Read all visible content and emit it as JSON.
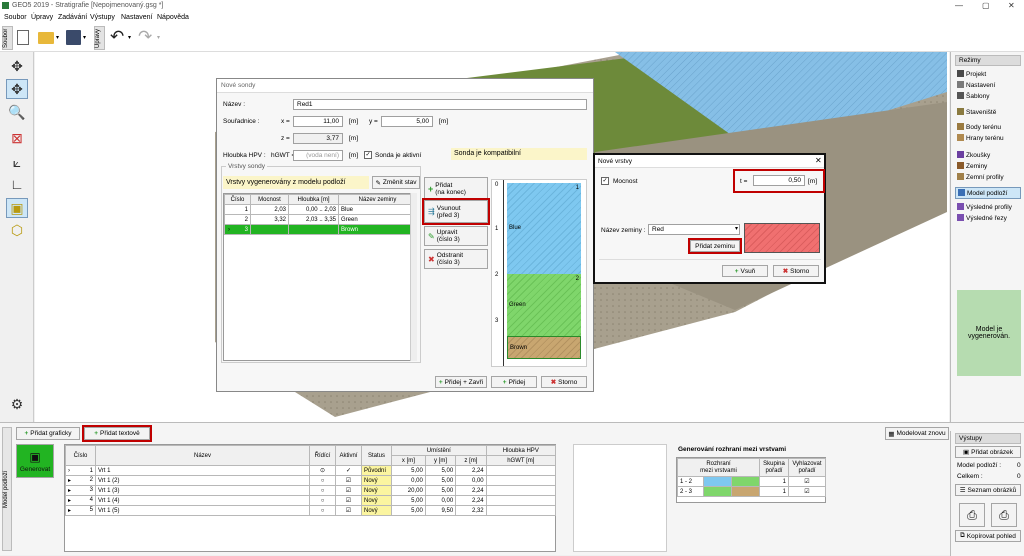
{
  "window": {
    "title": "GEO5 2019 - Stratigrafie [Nepojmenovaný.gsg *]"
  },
  "menu": [
    "Soubor",
    "Úpravy",
    "Zadávání",
    "Výstupy",
    "Nastavení",
    "Nápověda"
  ],
  "toolbar_tabs": {
    "file": "Soubor",
    "edit": "Úpravy"
  },
  "right_panel": {
    "header": "Režimy",
    "items": [
      {
        "label": "Projekt",
        "color": "#4a4a4a"
      },
      {
        "label": "Nastavení",
        "color": "#7a7a7a"
      },
      {
        "label": "Šablony",
        "color": "#555555"
      },
      {
        "label": "Staveniště",
        "color": "#8a7a40"
      },
      {
        "label": "Body terénu",
        "color": "#9a7a40"
      },
      {
        "label": "Hrany terénu",
        "color": "#b08a50"
      },
      {
        "label": "Zkoušky",
        "color": "#6b3fa0"
      },
      {
        "label": "Zeminy",
        "color": "#8a5a2a"
      },
      {
        "label": "Zemní profily",
        "color": "#a0804a"
      },
      {
        "label": "Model podloží",
        "color": "#3a6fb5"
      },
      {
        "label": "Výsledné profily",
        "color": "#7a4fb0"
      },
      {
        "label": "Výsledné řezy",
        "color": "#7a4fb0"
      }
    ],
    "status_text": "Model je vygenerován.",
    "outputs_header": "Výstupy",
    "add_image": "Přidat obrázek",
    "model_label": "Model podloží :",
    "model_value": "0",
    "total_label": "Celkem :",
    "total_value": "0",
    "image_list": "Seznam obrázků",
    "copy_view": "Kopírovat pohled"
  },
  "probe_dialog": {
    "title": "Nové sondy",
    "name_label": "Název :",
    "name_value": "Red1",
    "coords_label": "Souřadnice :",
    "x_label": "x =",
    "x_value": "11,00",
    "x_unit": "[m]",
    "y_label": "y =",
    "y_value": "5,00",
    "y_unit": "[m]",
    "z_label": "z =",
    "z_value": "3,77",
    "z_unit": "[m]",
    "hpv_label": "Hloubka HPV :",
    "hpv_sym": "hGWT =",
    "hpv_placeholder": "(voda není)",
    "hpv_unit": "[m]",
    "active_label": "Sonda je aktivní",
    "compat_text": "Sonda je kompatibilní",
    "layers_group": "Vrstvy sondy",
    "generated_note": "Vrstvy vygenerovány z modelu podloží",
    "change_state": "Změnit stav",
    "columns": [
      "Číslo",
      "Mocnost",
      "Hloubka [m]",
      "Název zeminy"
    ],
    "rows": [
      {
        "num": "1",
        "thick": "2,03",
        "depth": "0,00 .. 2,03",
        "soil": "Blue"
      },
      {
        "num": "2",
        "thick": "3,32",
        "depth": "2,03 .. 3,35",
        "soil": "Green"
      },
      {
        "num": "3",
        "thick": "",
        "depth": "",
        "soil": "Brown"
      }
    ],
    "add_end": "Přidat\n(na konec)",
    "insert": "Vsunout\n(před 3)",
    "edit": "Upravit\n(číslo 3)",
    "remove": "Odstranit\n(číslo 3)",
    "add_close": "Přidej + Zavři",
    "add": "Přidej",
    "cancel": "Storno",
    "profile": {
      "ticks": [
        "0",
        "1",
        "2",
        "3"
      ],
      "layers": [
        {
          "label": "Blue",
          "num": "1",
          "color": "#7ec8f0"
        },
        {
          "label": "Green",
          "num": "2",
          "color": "#7fd66b"
        },
        {
          "label": "Brown",
          "num": "",
          "color": "#c8a670"
        }
      ]
    }
  },
  "layer_dialog": {
    "title": "Nové vrstvy",
    "thick_label": "Mocnost",
    "t_label": "t =",
    "t_value": "0,50",
    "t_unit": "[m]",
    "soil_label": "Název zeminy :",
    "soil_value": "Red",
    "add_soil": "Přidat zeminu",
    "add": "Vsuň",
    "cancel": "Storno",
    "preview_color": "#f07070"
  },
  "bottom": {
    "add_graphic": "Přidat graficky",
    "add_text": "Přidat textově",
    "model_button": "Modelovat znovu",
    "side_tab": "Model podloží",
    "generate": "Generovat",
    "columns": [
      "Číslo",
      "Název",
      "Řídící",
      "Aktivní",
      "Status",
      "Umístění",
      "Hloubka HPV"
    ],
    "subcols": [
      "x [m]",
      "y [m]",
      "z [m]",
      "hGWT [m]"
    ],
    "rows": [
      {
        "num": "1",
        "name": "Vrt 1",
        "status": "Původní",
        "x": "5,00",
        "y": "5,00",
        "z": "2,24",
        "sel": true
      },
      {
        "num": "2",
        "name": "Vrt 1 (2)",
        "status": "Nový",
        "x": "0,00",
        "y": "5,00",
        "z": "0,00"
      },
      {
        "num": "3",
        "name": "Vrt 1 (3)",
        "status": "Nový",
        "x": "20,00",
        "y": "5,00",
        "z": "2,24"
      },
      {
        "num": "4",
        "name": "Vrt 1 (4)",
        "status": "Nový",
        "x": "5,00",
        "y": "0,00",
        "z": "2,24"
      },
      {
        "num": "5",
        "name": "Vrt 1 (5)",
        "status": "Nový",
        "x": "5,00",
        "y": "9,50",
        "z": "2,32"
      }
    ],
    "interface_title": "Generování rozhraní mezi vrstvami",
    "if_cols": [
      "Rozhraní\nmezi vrstvami",
      "Skupina\npořadí",
      "Vyhlazovat\npořadí"
    ],
    "if_rows": [
      {
        "pair": "1 - 2",
        "c1": "#7ec8f0",
        "c2": "#7fd66b",
        "group": "1"
      },
      {
        "pair": "2 - 3",
        "c1": "#7fd66b",
        "c2": "#c8a670",
        "group": "1"
      }
    ]
  }
}
